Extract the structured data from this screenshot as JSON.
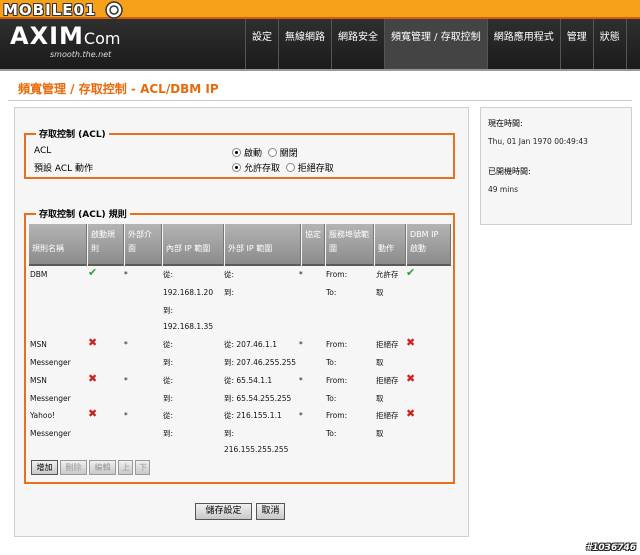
{
  "watermark": {
    "top": "MOBILE01",
    "bottom": "#1036746"
  },
  "logo": {
    "main": "AXIM",
    "com": "Com",
    "tagline": "smooth.the.net"
  },
  "nav": [
    {
      "label": "設定"
    },
    {
      "label": "無線網路"
    },
    {
      "label": "網路安全"
    },
    {
      "label": "頻寬管理 / 存取控制",
      "active": true
    },
    {
      "label": "網路應用程式"
    },
    {
      "label": "管理"
    },
    {
      "label": "狀態"
    }
  ],
  "page_title": "頻寬管理 / 存取控制 - ACL/DBM IP",
  "acl": {
    "legend": "存取控制 (ACL)",
    "acl_label": "ACL",
    "enable_label": "啟動",
    "disable_label": "關閉",
    "default_label": "預設 ACL 動作",
    "allow_label": "允許存取",
    "deny_label": "拒絕存取",
    "acl_value": "enable",
    "default_value": "allow"
  },
  "rules": {
    "legend": "存取控制 (ACL) 規則",
    "headers": [
      "規則名稱",
      "啟動規則",
      "外部介面",
      "內部 IP 範圍",
      "外部 IP 範圍",
      "協定",
      "服務埠號範圍",
      "動作",
      "DBM IP 啟動"
    ],
    "rows": [
      {
        "name": [
          "DBM"
        ],
        "enabled": "check",
        "iface": "*",
        "internal": [
          "從:",
          "192.168.1.20",
          "到:",
          "192.168.1.35"
        ],
        "external": [
          "從:",
          "到:"
        ],
        "proto": "*",
        "ports": [
          "From:",
          "To:"
        ],
        "action": [
          "允許存",
          "取"
        ],
        "dbm": "check"
      },
      {
        "name": [
          "MSN",
          "Messenger"
        ],
        "enabled": "cross",
        "iface": "*",
        "internal": [
          "從:",
          "到:"
        ],
        "external": [
          "從: 207.46.1.1",
          "到: 207.46.255.255"
        ],
        "proto": "*",
        "ports": [
          "From:",
          "To:"
        ],
        "action": [
          "拒絕存",
          "取"
        ],
        "dbm": "cross"
      },
      {
        "name": [
          "MSN",
          "Messenger"
        ],
        "enabled": "cross",
        "iface": "*",
        "internal": [
          "從:",
          "到:"
        ],
        "external": [
          "從: 65.54.1.1",
          "到: 65.54.255.255"
        ],
        "proto": "*",
        "ports": [
          "From:",
          "To:"
        ],
        "action": [
          "拒絕存",
          "取"
        ],
        "dbm": "cross"
      },
      {
        "name": [
          "Yahoo!",
          "Messenger"
        ],
        "enabled": "cross",
        "iface": "*",
        "internal": [
          "從:",
          "到:"
        ],
        "external": [
          "從: 216.155.1.1",
          "到:",
          "216.155.255.255"
        ],
        "proto": "*",
        "ports": [
          "From:",
          "To:"
        ],
        "action": [
          "拒絕存",
          "取"
        ],
        "dbm": "cross"
      }
    ],
    "buttons": {
      "add": "增加",
      "delete": "刪除",
      "edit": "編輯",
      "up": "上",
      "down": "下"
    }
  },
  "footer_buttons": {
    "save": "儲存設定",
    "cancel": "取消"
  },
  "status": {
    "time_label": "現在時間:",
    "time_value": "Thu, 01 Jan 1970 00:49:43",
    "uptime_label": "已開機時間:",
    "uptime_value": "49 mins"
  },
  "colors": {
    "accent": "#e8701b",
    "top_band": "#f7a11b",
    "header": "#2a2a2a",
    "check": "#27a33c",
    "cross": "#cc1f1f"
  }
}
